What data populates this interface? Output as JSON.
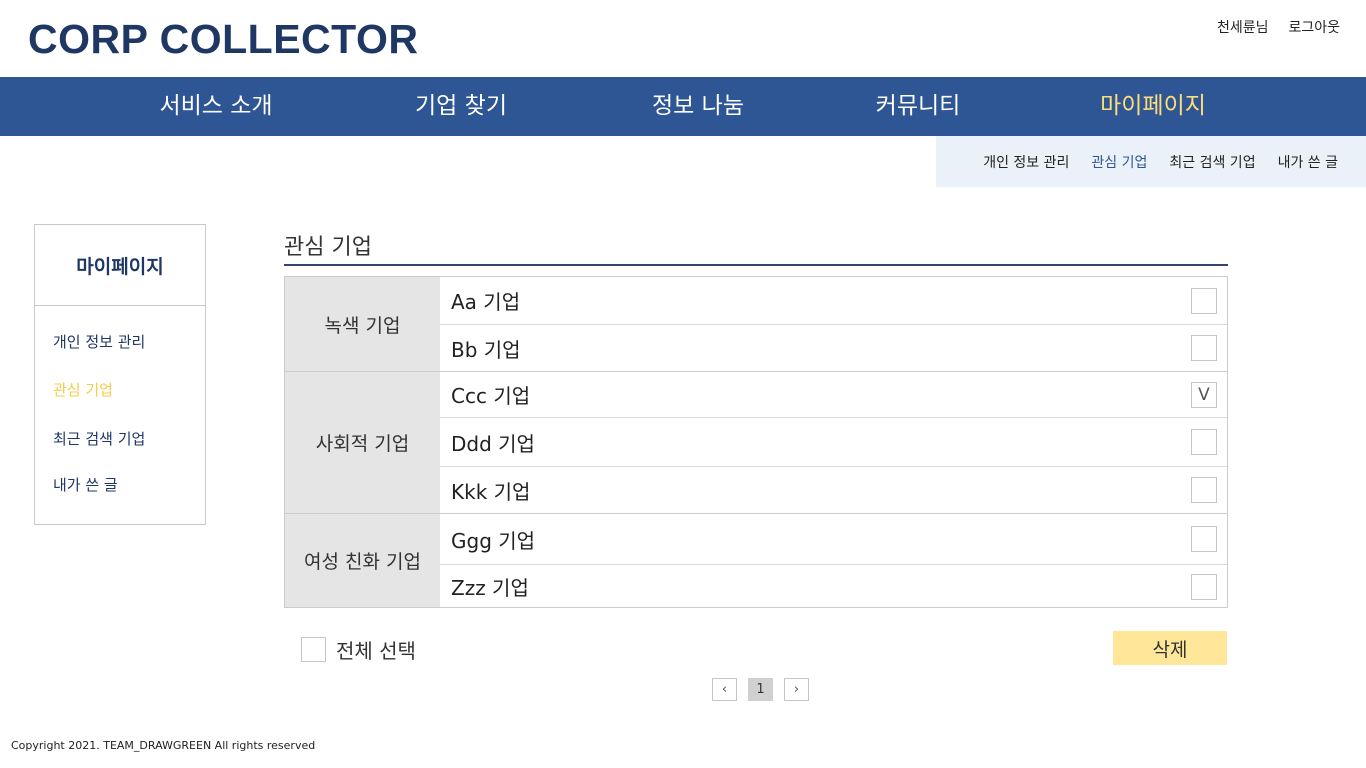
{
  "header": {
    "logo": "CORP COLLECTOR",
    "user_name": "천세륜님",
    "logout": "로그아웃"
  },
  "nav": {
    "items": [
      {
        "label": "서비스 소개"
      },
      {
        "label": "기업 찾기"
      },
      {
        "label": "정보 나눔"
      },
      {
        "label": "커뮤니티"
      },
      {
        "label": "마이페이지"
      }
    ],
    "active_index": 4
  },
  "subnav": {
    "items": [
      {
        "label": "개인 정보 관리"
      },
      {
        "label": "관심 기업"
      },
      {
        "label": "최근 검색 기업"
      },
      {
        "label": "내가 쓴 글"
      }
    ],
    "active_index": 1
  },
  "sidebar": {
    "title": "마이페이지",
    "items": [
      {
        "label": "개인 정보 관리"
      },
      {
        "label": "관심 기업"
      },
      {
        "label": "최근 검색 기업"
      },
      {
        "label": "내가 쓴 글"
      }
    ],
    "active_index": 1
  },
  "main": {
    "title": "관심 기업",
    "groups": [
      {
        "category": "녹색 기업",
        "companies": [
          {
            "name": "Aa 기업",
            "checked": false,
            "mark": ""
          },
          {
            "name": "Bb 기업",
            "checked": false,
            "mark": ""
          }
        ]
      },
      {
        "category": "사회적 기업",
        "companies": [
          {
            "name": "Ccc 기업",
            "checked": true,
            "mark": "V"
          },
          {
            "name": "Ddd 기업",
            "checked": false,
            "mark": ""
          },
          {
            "name": "Kkk 기업",
            "checked": false,
            "mark": ""
          }
        ]
      },
      {
        "category": "여성 친화 기업",
        "companies": [
          {
            "name": "Ggg 기업",
            "checked": false,
            "mark": ""
          },
          {
            "name": "Zzz 기업",
            "checked": false,
            "mark": ""
          }
        ]
      }
    ],
    "select_all_label": "전체 선택",
    "delete_label": "삭제"
  },
  "pagination": {
    "prev_icon": "‹",
    "current_page": "1",
    "next_icon": "›"
  },
  "footer": {
    "copyright": "Copyright 2021. TEAM_DRAWGREEN All rights reserved"
  },
  "colors": {
    "brand_navy": "#1f3763",
    "nav_blue": "#2e5694",
    "accent_yellow": "#ffdd7a",
    "delete_button": "#ffe699"
  }
}
